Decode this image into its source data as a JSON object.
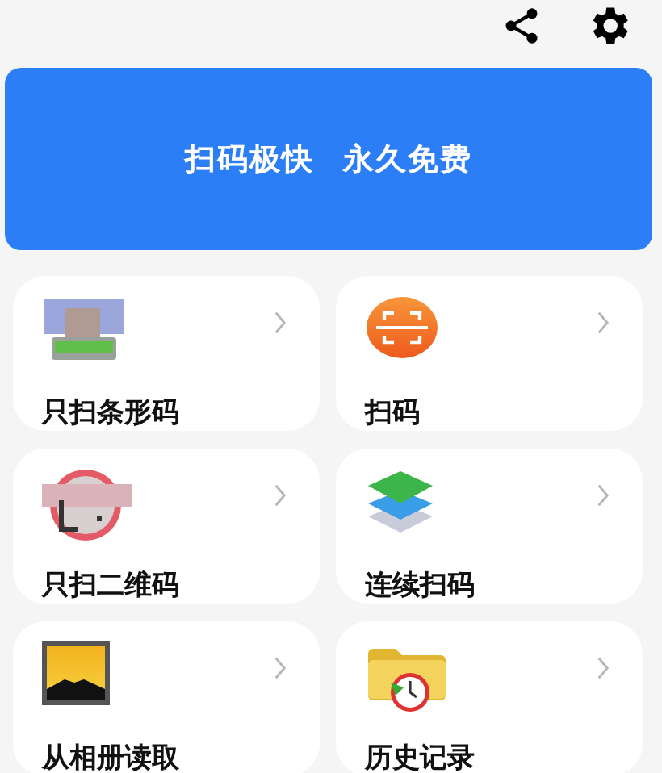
{
  "banner": {
    "text": "扫码极快 永久免费"
  },
  "cards": [
    {
      "kind": "barcode",
      "title": "只扫条形码"
    },
    {
      "kind": "scan",
      "title": "扫码"
    },
    {
      "kind": "qrcode",
      "title": "只扫二维码"
    },
    {
      "kind": "layers",
      "title": "连续扫码"
    },
    {
      "kind": "album",
      "title": "从相册读取"
    },
    {
      "kind": "history",
      "title": "历史记录"
    }
  ]
}
